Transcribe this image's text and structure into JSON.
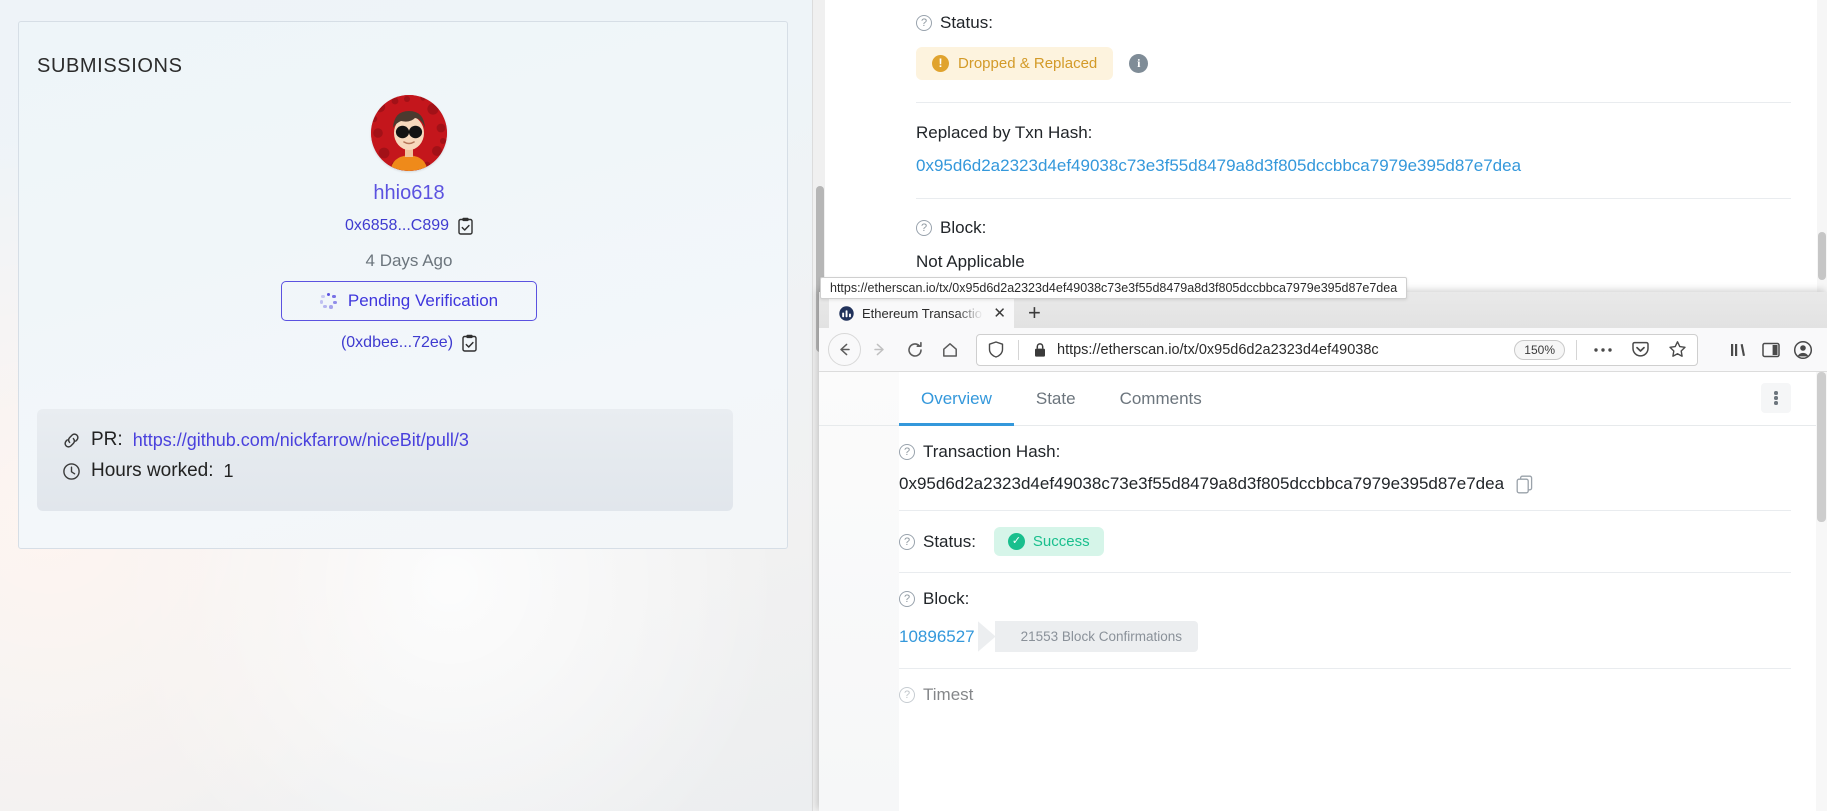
{
  "left_app": {
    "card_title": "SUBMISSIONS",
    "submission": {
      "username": "hhio618",
      "avatar_name": "avatar-hhio618",
      "wallet_address": "0x6858...C899",
      "wallet_copy_icon": "clipboard-check-icon",
      "time_ago": "4 Days Ago",
      "status_button": "Pending Verification",
      "status_spinner_icon": "spinner-icon",
      "txn_ref": "(0xdbee...72ee)",
      "txn_copy_icon": "clipboard-check-icon"
    },
    "details": {
      "link_icon": "link-icon",
      "pr_label": "PR:",
      "pr_url": "https://github.com/nickfarrow/niceBit/pull/3",
      "clock_icon": "clock-icon",
      "hours_label": "Hours worked:",
      "hours_value": "1"
    },
    "colors": {
      "accent_purple": "#5b52e0",
      "link_purple": "#3f3bd0",
      "card_bg": "#eef5f9"
    }
  },
  "background_page": {
    "status_label": "Status:",
    "status_help_icon": "question-circle-icon",
    "status_badge": "Dropped & Replaced",
    "status_badge_icon": "warning-icon",
    "status_info_icon": "info-circle-icon",
    "replaced_label": "Replaced by Txn Hash:",
    "replaced_hash": "0x95d6d2a2323d4ef49038c73e3f55d8479a8d3f805dccbbca7979e395d87e7dea",
    "block_label": "Block:",
    "block_help_icon": "question-circle-icon",
    "block_value": "Not Applicable"
  },
  "url_tooltip": {
    "text": "https://etherscan.io/tx/0x95d6d2a2323d4ef49038c73e3f55d8479a8d3f805dccbbca7979e395d87e7dea"
  },
  "browser": {
    "tab": {
      "favicon_icon": "etherscan-favicon",
      "title": "Ethereum Transaction Ha",
      "close_icon": "close-icon"
    },
    "new_tab_icon": "plus-icon",
    "nav": {
      "back_icon": "arrow-left-icon",
      "forward_icon": "arrow-right-icon",
      "reload_icon": "reload-icon",
      "home_icon": "home-icon"
    },
    "urlbar": {
      "shield_icon": "shield-icon",
      "lock_icon": "padlock-icon",
      "url": "https://etherscan.io/tx/0x95d6d2a2323d4ef49038c",
      "zoom_level": "150%",
      "more_icon": "ellipsis-icon",
      "pocket_icon": "pocket-icon",
      "bookmark_icon": "star-icon"
    },
    "toolbar_right": {
      "library_icon": "library-icon",
      "sidebar_icon": "sidebar-icon",
      "account_icon": "account-circle-icon"
    }
  },
  "etherscan": {
    "tabs": [
      {
        "label": "Overview",
        "active": true
      },
      {
        "label": "State",
        "active": false
      },
      {
        "label": "Comments",
        "active": false
      }
    ],
    "kebab_icon": "kebab-menu-icon",
    "rows": {
      "txhash_label": "Transaction Hash:",
      "txhash_help_icon": "question-circle-icon",
      "txhash_value": "0x95d6d2a2323d4ef49038c73e3f55d8479a8d3f805dccbbca7979e395d87e7dea",
      "txhash_copy_icon": "copy-icon",
      "status_label": "Status:",
      "status_help_icon": "question-circle-icon",
      "status_value": "Success",
      "status_value_icon": "check-circle-icon",
      "block_label": "Block:",
      "block_help_icon": "question-circle-icon",
      "block_number": "10896527",
      "block_confirmations": "21553 Block Confirmations",
      "timestamp_label_partial": "Timest"
    },
    "colors": {
      "link_blue": "#3498db",
      "success_green": "#19bf8d",
      "success_bg": "#d6f5e9",
      "warn_amber": "#d39a28",
      "warn_bg": "#fdf3de"
    }
  }
}
